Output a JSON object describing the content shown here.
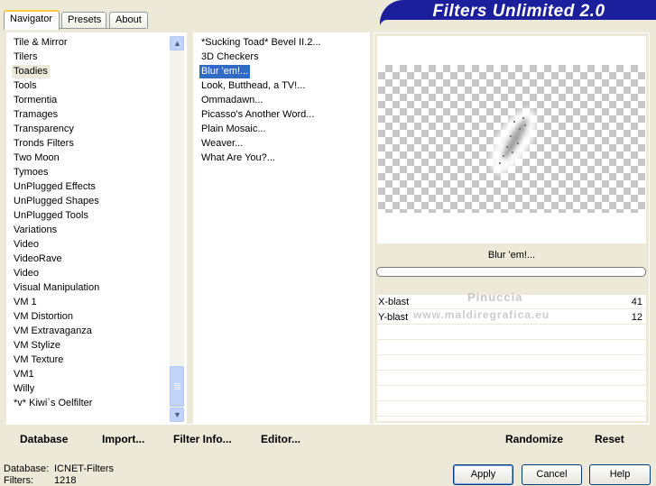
{
  "tabs": [
    {
      "label": "Navigator",
      "active": true
    },
    {
      "label": "Presets",
      "active": false
    },
    {
      "label": "About",
      "active": false
    }
  ],
  "banner": {
    "title": "Filters Unlimited 2.0"
  },
  "categories": {
    "items": [
      "Tile & Mirror",
      "Tilers",
      "Toadies",
      "Tools",
      "Tormentia",
      "Tramages",
      "Transparency",
      "Tronds Filters",
      "Two Moon",
      "Tymoes",
      "UnPlugged Effects",
      "UnPlugged Shapes",
      "UnPlugged Tools",
      "Variations",
      "Video",
      "VideoRave",
      "Video",
      "Visual Manipulation",
      "VM 1",
      "VM Distortion",
      "VM Extravaganza",
      "VM Stylize",
      "VM Texture",
      "VM1",
      "Willy",
      "*v* Kiwi`s Oelfilter"
    ],
    "selected": "Toadies"
  },
  "filters": {
    "items": [
      "*Sucking Toad*  Bevel II.2...",
      "3D Checkers",
      "Blur 'em!...",
      "Look, Butthead, a TV!...",
      "Ommadawn...",
      "Picasso's Another Word...",
      "Plain Mosaic...",
      "Weaver...",
      "What Are You?..."
    ],
    "selected": "Blur 'em!..."
  },
  "preview": {
    "caption": "Blur 'em!..."
  },
  "params": [
    {
      "label": "X-blast",
      "value": "41"
    },
    {
      "label": "Y-blast",
      "value": "12"
    }
  ],
  "watermark": {
    "line1": "Pinuccia",
    "line2": "www.maldiregrafica.eu"
  },
  "toolbar": {
    "database": "Database",
    "import": "Import...",
    "filter_info": "Filter Info...",
    "editor": "Editor...",
    "randomize": "Randomize",
    "reset": "Reset"
  },
  "status": {
    "database_label": "Database:",
    "database_value": "ICNET-Filters",
    "filters_label": "Filters:",
    "filters_value": "1218"
  },
  "buttons": {
    "apply": "Apply",
    "cancel": "Cancel",
    "help": "Help"
  },
  "colors": {
    "banner": "#1b1f9c",
    "selection": "#316ac5",
    "face": "#ece9d8"
  }
}
